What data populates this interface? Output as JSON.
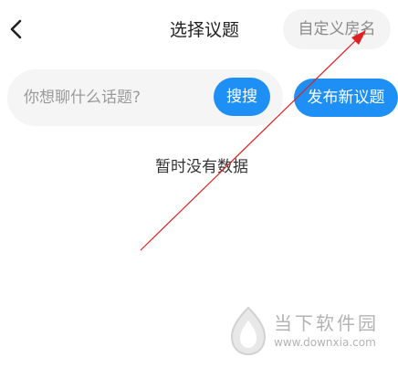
{
  "header": {
    "back_icon": "chevron-left-icon",
    "title": "选择议题",
    "custom_room_label": "自定义房名"
  },
  "search": {
    "placeholder": "你想聊什么话题?",
    "value": "",
    "button_label": "搜搜"
  },
  "publish": {
    "label": "发布新议题"
  },
  "content": {
    "empty_text": "暂时没有数据"
  },
  "annotation": {
    "arrow_color": "#e02020"
  },
  "watermark": {
    "name": "当下软件园",
    "url": "www.downxia.com"
  },
  "colors": {
    "accent": "#1e90f5"
  }
}
